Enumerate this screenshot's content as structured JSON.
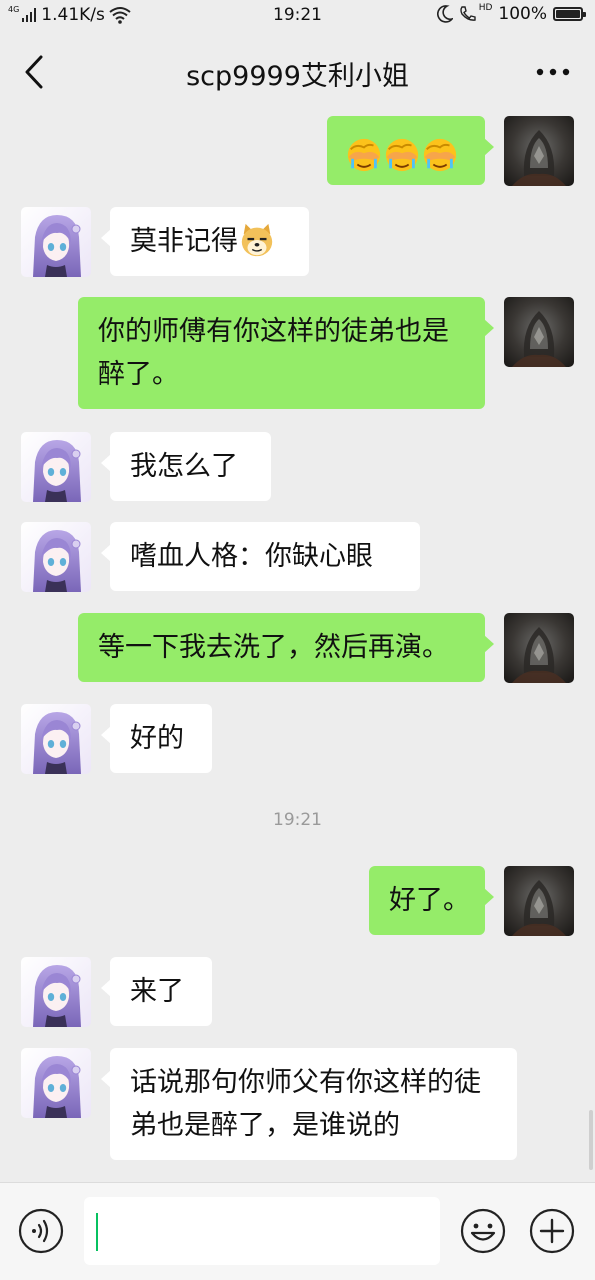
{
  "status_bar": {
    "network_tag": "4G",
    "speed": "1.41K/s",
    "time": "19:21",
    "hd_label": "HD",
    "battery": "100%"
  },
  "header": {
    "title": "scp9999艾利小姐"
  },
  "messages": [
    {
      "side": "right",
      "emoji": [
        "face-palm-crying",
        "face-palm-crying",
        "face-palm-crying"
      ]
    },
    {
      "side": "left",
      "text": "莫非记得",
      "emoji": [
        "doge-dog"
      ]
    },
    {
      "side": "right",
      "text": "你的师傅有你这样的徒弟也是醉了。"
    },
    {
      "side": "left",
      "text": "我怎么了"
    },
    {
      "side": "left",
      "text": "嗜血人格：你缺心眼"
    },
    {
      "side": "right",
      "text": "等一下我去洗了，然后再演。"
    },
    {
      "side": "left",
      "text": "好的"
    },
    {
      "side": "right",
      "text": "好了。"
    },
    {
      "side": "left",
      "text": "来了"
    },
    {
      "side": "left",
      "text": "话说那句你师父有你这样的徒弟也是醉了，是谁说的"
    }
  ],
  "timestamp": "19:21",
  "input": {
    "value": ""
  },
  "colors": {
    "background": "#ededed",
    "outgoing_bubble": "#95ec69",
    "incoming_bubble": "#ffffff",
    "caret": "#07c160"
  }
}
